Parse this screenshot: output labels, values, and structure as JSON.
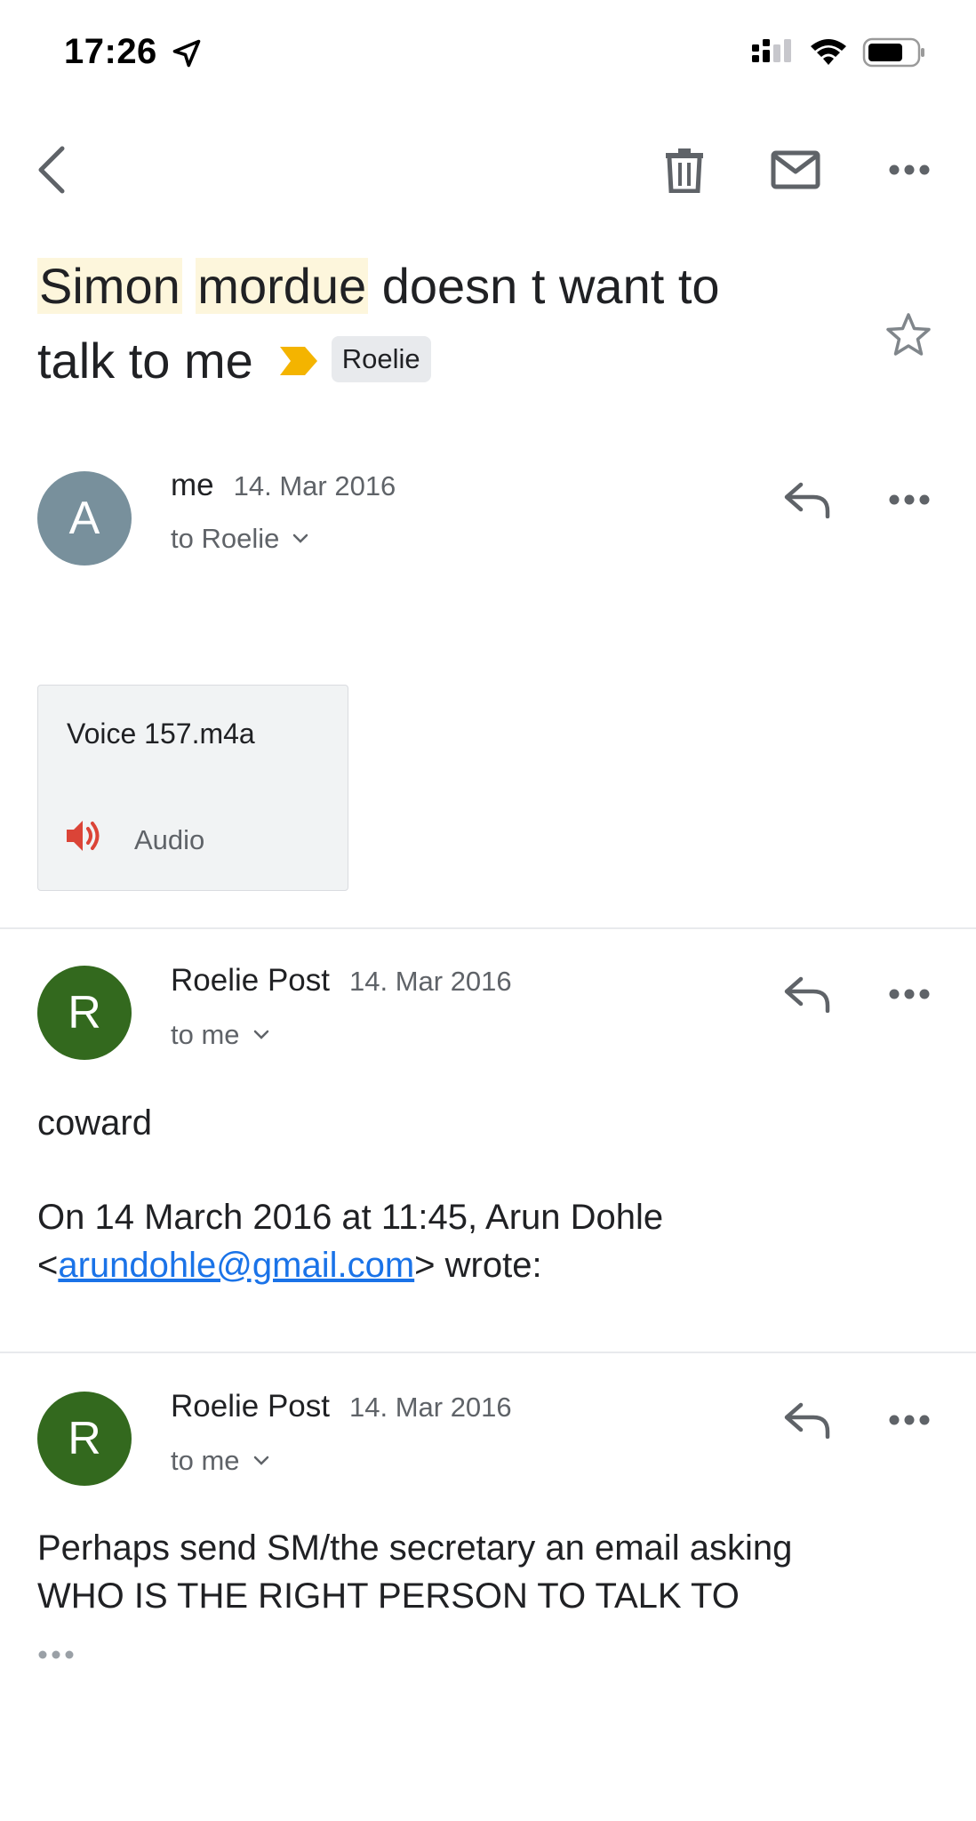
{
  "status_bar": {
    "time": "17:26"
  },
  "subject": {
    "highlight_1": "Simon",
    "highlight_2": "mordue",
    "line_1_rest": "doesn t want to",
    "line_2": "talk to me",
    "label": "Roelie"
  },
  "messages": [
    {
      "avatar_letter": "A",
      "avatar_color": "#78909c",
      "sender": "me",
      "date": "14. Mar 2016",
      "recipient": "to Roelie",
      "attachment": {
        "name": "Voice 157.m4a",
        "type": "Audio",
        "icon": "audio-icon"
      }
    },
    {
      "avatar_letter": "R",
      "avatar_color": "#33691e",
      "sender": "Roelie Post",
      "date": "14. Mar 2016",
      "recipient": "to me",
      "body": "coward",
      "quote_prefix": "On 14 March 2016 at 11:45, Arun Dohle",
      "quote_open": "<",
      "quote_email": "arundohle@gmail.com",
      "quote_suffix": "> wrote:"
    },
    {
      "avatar_letter": "R",
      "avatar_color": "#33691e",
      "sender": "Roelie Post",
      "date": "14. Mar 2016",
      "recipient": "to me",
      "body_line_1": "Perhaps send SM/the secretary an email asking",
      "body_line_2": "WHO IS THE RIGHT PERSON TO TALK TO"
    }
  ],
  "colors": {
    "important": "#f4b400",
    "link": "#1a73e8",
    "audio_icon": "#db4437"
  }
}
